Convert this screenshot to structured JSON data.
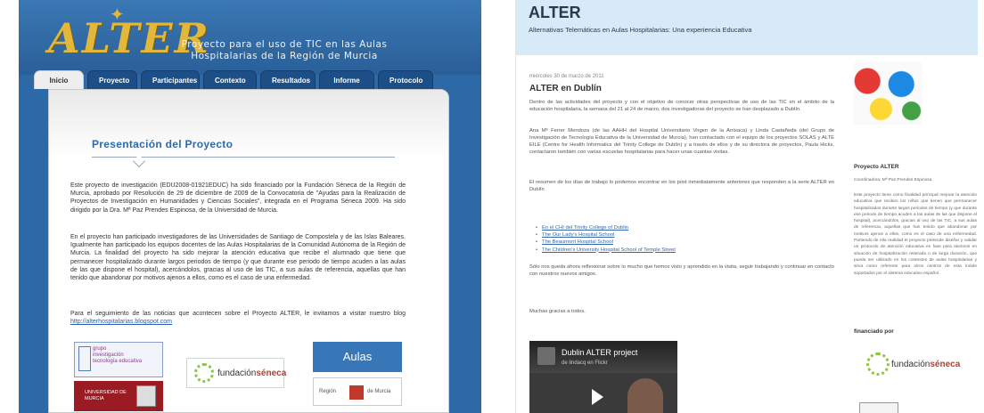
{
  "left": {
    "logo": "ALTER",
    "tagline": [
      "Proyecto para el uso de TIC en las Aulas",
      "Hospitalarias de la Región de Murcia"
    ],
    "tabs": [
      {
        "label": "Inicio",
        "active": true
      },
      {
        "label": "Proyecto",
        "active": false
      },
      {
        "label": "Participantes",
        "active": false
      },
      {
        "label": "Contexto",
        "active": false
      },
      {
        "label": "Resultados",
        "active": false
      },
      {
        "label": "Informe",
        "active": false
      },
      {
        "label": "Protocolo",
        "active": false
      }
    ],
    "section_title": "Presentación del Proyecto",
    "paragraph_1": "Este proyecto de investigación (EDU2008-01921EDUC) ha sido financiado por la Fundación Séneca de la Región de Murcia, aprobado por Resolución de 29 de diciembre de 2009 de la Convocatoria de \"Ayudas para la Realización de Proyectos de Investigación en Humanidades y Ciencias Sociales\", integrada en el Programa Séneca 2009. Ha sido dirigido por la Dra. Mª Paz Prendes Espinosa, de la Universidad de Murcia.",
    "paragraph_2": "En el proyecto han participado investigadores de las Universidades de Santiago de Compostela y de las Islas Baleares. Igualmente han participado los equipos docentes de las Aulas Hospitalarias de la Comunidad Autónoma de la Región de Murcia. La finalidad del proyecto ha sido mejorar la atención educativa que recibe el alumnado que tiene que permanecer hospitalizado durante largos periodos de tiempo (y que durante ese periodo de tiempo acuden a las aulas de las que dispone el hospital), acercándolos, gracias al uso de las TIC, a sus aulas de referencia, aquellas que han tenido que abandonar por motivos ajenos a ellos, como es el caso de una enfermedad.",
    "paragraph_3": "Para el seguimiento de las noticias que acontecen sobre el Proyecto ALTER, le invitamos a visitar nuestro blog",
    "blog_link": "http://alterhospitalarias.blogspot.com",
    "logos": {
      "grupo": [
        "grupo",
        "investigación",
        "tecnología educativa"
      ],
      "universidad": [
        "UNIVERSIDAD DE",
        "MURCIA"
      ],
      "fundacion": {
        "a": "fundación",
        "b": "séneca"
      },
      "aulas": "Aulas hospitalarias",
      "region": {
        "a": "Región",
        "b": "de Murcia"
      }
    }
  },
  "right": {
    "blog_title": "ALTER",
    "blog_subtitle": "Alternativas Telemáticas en Aulas Hospitalarias: Una experiencia Educativa",
    "post_date": "miércoles 30 de marzo de 2011",
    "post_title": "ALTER en Dublín",
    "post_p1": "Dentro de las actividades del proyecto y con el objetivo de conocer otras perspectivas de uso de las TIC en el ámbito de la educación hospitalaria, la semana del 21 al 24 de marzo, dos investigadoras del proyecto se han desplazado a Dublín.",
    "post_p2": "Ana Mª Ferrer Mendoza (de las AAHH del Hospital Universitario Virgen de la Arrixaca) y Linda Castañeda (del Grupo de Investigación de Tecnología Educativa de la Universidad de Murcia), han contactado con el equipo de los proyectos SOLAS y ALTE EILE (Centre for Health Informatics del Trinity College de Dublín) y a través de ellos y de su directora de proyectos, Paula Hicks, contactaron también con varias escuelas hospitalarias para hacer unas cuantas visitas.",
    "post_p3": "El resumen de los días de trabajo lo podemos encontrar en los post inmediatamente anteriores que responden a la serie ALTER en Dublín",
    "post_links": [
      "En el CHI del Trinity College of Dublin",
      "The Our Lady's Hospital School",
      "The Beaumont Hospital School",
      "The Children's University Hospital School of Temple Street"
    ],
    "post_p4": "Sólo nos queda ahora reflexionar sobre lo mucho que hemos visto y aprendido en la visita, seguir trabajando y continuar en contacto con nuestros nuevos amigos.",
    "post_p5": "Muchas gracias a todos.",
    "video": {
      "title": "Dublin ALTER project",
      "source": "de lindacq en Flickr"
    },
    "sidebar": {
      "heading": "Proyecto ALTER",
      "coordinator": "Coordinadora: Mª Paz Prendes Espinosa",
      "description": "Este proyecto tiene como finalidad principal mejorar la atención educativa que reciben los niños que tienen que permanecer hospitalizados durante largos periodos de tiempo (y que durante ese periodo de tiempo acuden a las aulas de las que dispone el hospital), acercándolos, gracias al uso de las TIC, a sus aulas de referencia, aquellas que han tenido que abandonar por motivos ajenos a ellos, como es el caso de una enfermedad. Partiendo de ella realidad el proyecto pretende diseñar y validar un protocolo de atención educativa en fase para alumnos en situación de hospitalización reiterada o de larga duración, que pueda ser utilizado en los contextos de aulas hospitalarias y sirva como referente para otros centros de esta índole soportados por el sistema educativo español.",
      "funded_by": "financiado por",
      "fundacion": {
        "a": "fundación",
        "b": "séneca"
      }
    }
  }
}
